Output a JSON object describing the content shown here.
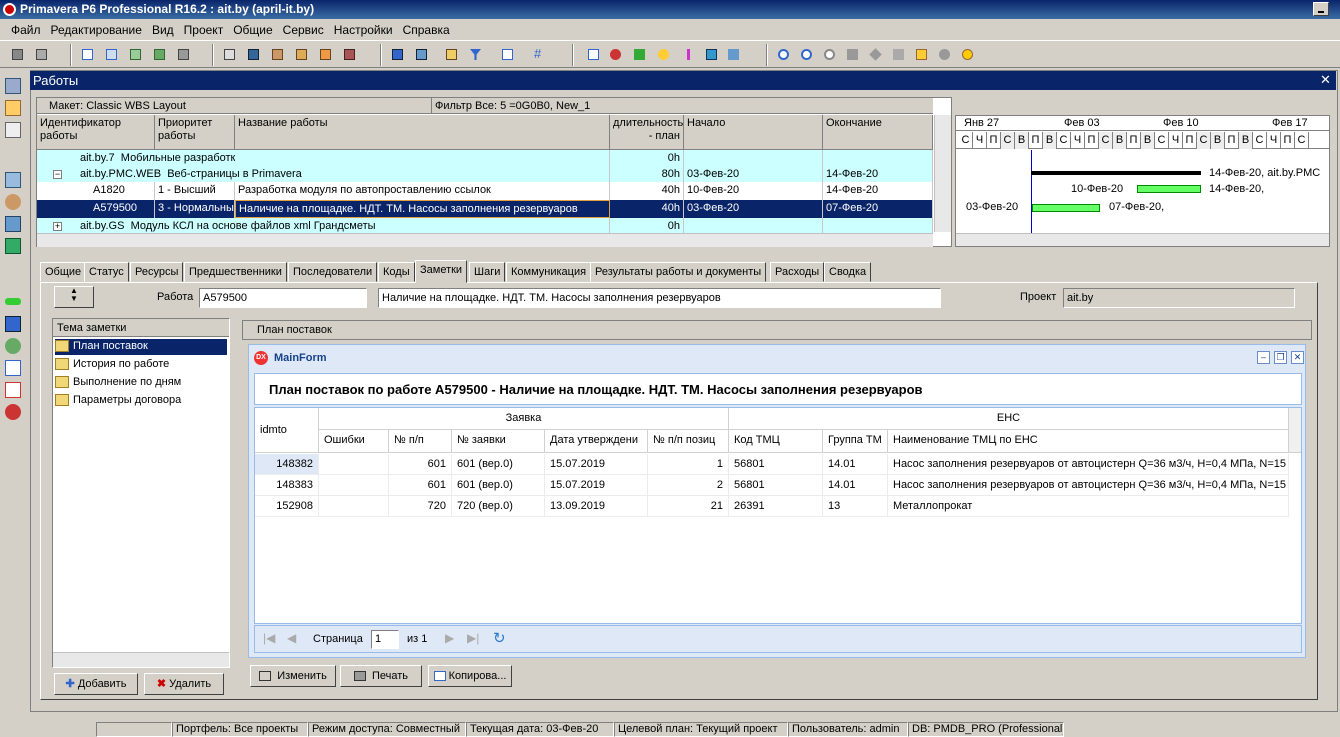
{
  "window": {
    "title": "Primavera P6 Professional R16.2 : ait.by (april-it.by)"
  },
  "menu": [
    "Файл",
    "Редактирование",
    "Вид",
    "Проект",
    "Общие",
    "Сервис",
    "Настройки",
    "Справка"
  ],
  "panel": {
    "title": "Работы"
  },
  "layout": {
    "label": "Макет: Classic WBS Layout",
    "filter": "Фильтр Все: 5 =0G0B0, New_1"
  },
  "columns": {
    "id": "Идентификатор работы",
    "priority": "Приоритет работы",
    "name": "Название работы",
    "duration": "длительность - план",
    "start": "Начало",
    "finish": "Окончание"
  },
  "rows": [
    {
      "id": "ait.by.7",
      "name": "Мобильные разработки",
      "duration": "0h",
      "start": "",
      "finish": ""
    },
    {
      "id": "ait.by.PMC.WEB",
      "name": "Веб-страницы в Primavera",
      "duration": "80h",
      "start": "03-Фев-20",
      "finish": "14-Фев-20"
    },
    {
      "id": "A1820",
      "priority": "1 - Высший",
      "name": "Разработка модуля по автопроставлению ссылок",
      "duration": "40h",
      "start": "10-Фев-20",
      "finish": "14-Фев-20"
    },
    {
      "id": "A579500",
      "priority": "3 - Нормальный",
      "name": "Наличие на площадке. НДТ. ТМ. Насосы заполнения резервуаров",
      "duration": "40h",
      "start": "03-Фев-20",
      "finish": "07-Фев-20"
    },
    {
      "id": "ait.by.GS",
      "name": "Модуль КСЛ на основе файлов xml Грандсметы",
      "duration": "0h",
      "start": "",
      "finish": ""
    }
  ],
  "gantt": {
    "weeks": [
      "Янв 27",
      "Фев 03",
      "Фев 10",
      "Фев 17"
    ],
    "days": [
      "С",
      "Ч",
      "П",
      "С",
      "В",
      "П",
      "В",
      "С",
      "Ч",
      "П",
      "С",
      "В",
      "П",
      "В",
      "С",
      "Ч",
      "П",
      "С",
      "В",
      "П",
      "В",
      "С",
      "Ч",
      "П",
      "С"
    ],
    "labels": {
      "r1_end": "14-Фев-20, ait.by.PMC",
      "r2_start": "10-Фев-20",
      "r2_end": "14-Фев-20,",
      "r3_start": "03-Фев-20",
      "r3_end": "07-Фев-20,"
    }
  },
  "tabs": [
    "Общие",
    "Статус",
    "Ресурсы",
    "Предшественники",
    "Последователи",
    "Коды",
    "Заметки",
    "Шаги",
    "Коммуникация",
    "Результаты работы и документы",
    "Расходы",
    "Сводка"
  ],
  "detail": {
    "work_label": "Работа",
    "work_id": "A579500",
    "work_name": "Наличие на площадке. НДТ. ТМ. Насосы заполнения резервуаров",
    "project_label": "Проект",
    "project": "ait.by"
  },
  "notes": {
    "header": "Тема заметки",
    "items": [
      "План поставок",
      "История по работе",
      "Выполнение по дням",
      "Параметры договора"
    ],
    "add": "Добавить",
    "delete": "Удалить",
    "content_title": "План поставок"
  },
  "mainform": {
    "title": "MainForm",
    "heading": "План поставок по работе А579500 - Наличие на площадке. НДТ. ТМ. Насосы заполнения резервуаров",
    "group_request": "Заявка",
    "group_ens": "ЕНС",
    "col_id": "idmto",
    "cols": [
      "Ошибки",
      "№ п/п",
      "№ заявки",
      "Дата утверждени",
      "№ п/п позиц",
      "Код ТМЦ",
      "Группа ТМ",
      "Наименование ТМЦ по ЕНС"
    ],
    "rows": [
      [
        "148382",
        "",
        "601",
        "601 (вер.0)",
        "15.07.2019",
        "1",
        "56801",
        "14.01",
        "Насос заполнения резервуаров от автоцистерн Q=36 м3/ч, Н=0,4 МПа, N=15"
      ],
      [
        "148383",
        "",
        "601",
        "601 (вер.0)",
        "15.07.2019",
        "2",
        "56801",
        "14.01",
        "Насос заполнения резервуаров от автоцистерн Q=36 м3/ч, Н=0,4 МПа, N=15"
      ],
      [
        "152908",
        "",
        "720",
        "720 (вер.0)",
        "13.09.2019",
        "21",
        "26391",
        "13",
        "Металлопрокат"
      ]
    ],
    "pager": {
      "page_label": "Страница",
      "page": "1",
      "of": "из 1"
    }
  },
  "buttons": {
    "edit": "Изменить",
    "print": "Печать",
    "copy": "Копирова..."
  },
  "status": [
    "Портфель: Все проекты",
    "Режим доступа: Совместный",
    "Текущая дата: 03-Фев-20",
    "Целевой план: Текущий проект",
    "Пользователь: admin",
    "DB: PMDB_PRO (Professional)"
  ]
}
